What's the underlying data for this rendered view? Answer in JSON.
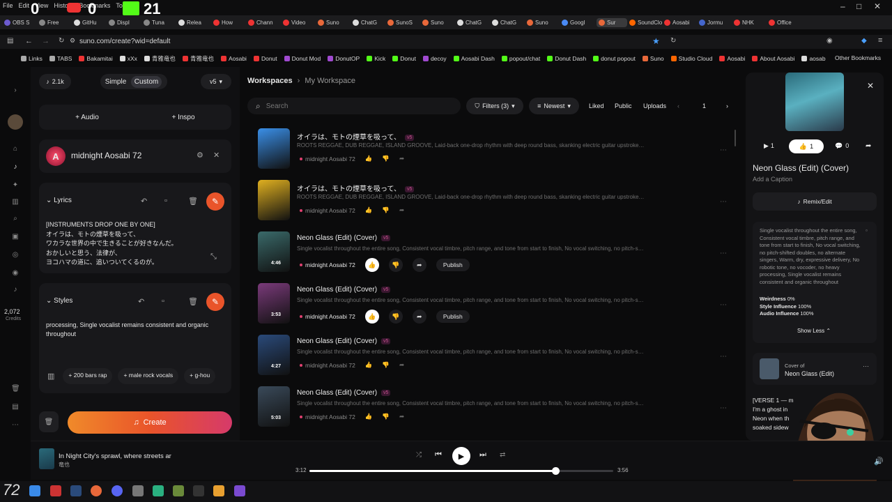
{
  "os": {
    "menu": [
      "File",
      "Edit",
      "View",
      "History",
      "Bookmarks",
      "Tools"
    ],
    "counter1": "0",
    "counter2": "0",
    "counter3": "21"
  },
  "tabs": [
    {
      "label": "OBS S",
      "color": "#6d5bd0"
    },
    {
      "label": "Free",
      "color": "#888"
    },
    {
      "label": "GitHu",
      "color": "#ddd"
    },
    {
      "label": "Displ",
      "color": "#888"
    },
    {
      "label": "Tuna",
      "color": "#888"
    },
    {
      "label": "Relea",
      "color": "#ddd"
    },
    {
      "label": "How",
      "color": "#e33"
    },
    {
      "label": "Chann",
      "color": "#e33"
    },
    {
      "label": "Video",
      "color": "#e33"
    },
    {
      "label": "Suno",
      "color": "#e8683a"
    },
    {
      "label": "ChatG",
      "color": "#ddd"
    },
    {
      "label": "SunoS",
      "color": "#e8683a"
    },
    {
      "label": "Suno",
      "color": "#e8683a"
    },
    {
      "label": "ChatG",
      "color": "#ddd"
    },
    {
      "label": "ChatG",
      "color": "#ddd"
    },
    {
      "label": "Suno",
      "color": "#e8683a"
    },
    {
      "label": "Googl",
      "color": "#4a8af4"
    },
    {
      "label": "Sur",
      "color": "#e8683a",
      "active": true
    },
    {
      "label": "SoundClou",
      "color": "#f60"
    },
    {
      "label": "Aosabi",
      "color": "#e33"
    },
    {
      "label": "Jormu",
      "color": "#4466cc"
    },
    {
      "label": "NHK",
      "color": "#e33"
    },
    {
      "label": "Office",
      "color": "#e33"
    }
  ],
  "address": {
    "url": "suno.com/create?wid=default"
  },
  "bookmarks": [
    {
      "label": "Links",
      "color": "#aaa"
    },
    {
      "label": "TABS",
      "color": "#aaa"
    },
    {
      "label": "Bakamitai",
      "color": "#e33"
    },
    {
      "label": "xXx",
      "color": "#ddd"
    },
    {
      "label": "青雅竜也",
      "color": "#ddd"
    },
    {
      "label": "青雅竜也",
      "color": "#e33"
    },
    {
      "label": "Aosabi",
      "color": "#e33"
    },
    {
      "label": "Donut",
      "color": "#e33"
    },
    {
      "label": "Donut Mod",
      "color": "#a04ad0"
    },
    {
      "label": "DonutOP",
      "color": "#a04ad0"
    },
    {
      "label": "Kick",
      "color": "#53fc18"
    },
    {
      "label": "Donut",
      "color": "#53fc18"
    },
    {
      "label": "decoy",
      "color": "#a04ad0"
    },
    {
      "label": "Aosabi Dash",
      "color": "#53fc18"
    },
    {
      "label": "popout/chat",
      "color": "#53fc18"
    },
    {
      "label": "Donut Dash",
      "color": "#53fc18"
    },
    {
      "label": "donut popout",
      "color": "#53fc18"
    },
    {
      "label": "Suno",
      "color": "#e8683a"
    },
    {
      "label": "Studio Cloud",
      "color": "#f60"
    },
    {
      "label": "Aosabi",
      "color": "#e33"
    },
    {
      "label": "About Aosabi",
      "color": "#e33"
    },
    {
      "label": "aosab",
      "color": "#ddd"
    }
  ],
  "bookmarks_other": "Other Bookmarks",
  "rail": {
    "credits_value": "2,072",
    "credits_label": "Credits"
  },
  "panel": {
    "count": "2.1k",
    "mode_simple": "Simple",
    "mode_custom": "Custom",
    "version": "v5",
    "audio": "Audio",
    "inspo": "Inspo",
    "persona": "midnight Aosabi 72",
    "lyrics_title": "Lyrics",
    "lyrics": [
      "[INSTRUMENTS DROP ONE BY ONE]",
      "オイラは、モトの煙草を吸って、",
      "ワカラな世界の中で生きることが好きなんだ。",
      "おかしいと思う、法律が、",
      "ヨコハマの道に、追いついてくるのが。"
    ],
    "styles_title": "Styles",
    "styles_text": "processing, Single vocalist remains consistent and organic throughout",
    "tags": [
      "200 bars rap",
      "male rock vocals",
      "g-hou"
    ],
    "create": "Create"
  },
  "main": {
    "crumb_root": "Workspaces",
    "crumb_current": "My Workspace",
    "search_placeholder": "Search",
    "filters": "Filters (3)",
    "sort": "Newest",
    "liked": "Liked",
    "public": "Public",
    "uploads": "Uploads",
    "page": "1",
    "rows": [
      {
        "title": "オイラは、モトの煙草を吸って、",
        "badge": "v5",
        "desc": "ROOTS REGGAE, DUB REGGAE, ISLAND GROOVE, Laid-back one-drop rhythm with deep round bass, skanking electric guitar upstrokes, rimsh...",
        "author": "midnight Aosabi 72",
        "duration": "",
        "thumb": "#3a8fe8",
        "on": false
      },
      {
        "title": "オイラは、モトの煙草を吸って、",
        "badge": "v5",
        "desc": "ROOTS REGGAE, DUB REGGAE, ISLAND GROOVE, Laid-back one-drop rhythm with deep round bass, skanking electric guitar upstrokes, rimsh...",
        "author": "midnight Aosabi 72",
        "duration": "",
        "thumb": "#e0b020",
        "on": false
      },
      {
        "title": "Neon Glass (Edit) (Cover)",
        "badge": "v5",
        "desc": "Single vocalist throughout the entire song, Consistent vocal timbre, pitch range, and tone from start to finish, No vocal switching, no pitch-shifted ...",
        "author": "midnight Aosabi 72",
        "duration": "4:46",
        "thumb": "#3a6a6a",
        "on": true,
        "publish": "Publish"
      },
      {
        "title": "Neon Glass (Edit) (Cover)",
        "badge": "v5",
        "desc": "Single vocalist throughout the entire song, Consistent vocal timbre, pitch range, and tone from start to finish, No vocal switching, no pitch-shifted ...",
        "author": "midnight Aosabi 72",
        "duration": "3:53",
        "thumb": "#7a3a7a",
        "on": true,
        "publish": "Publish"
      },
      {
        "title": "Neon Glass (Edit) (Cover)",
        "badge": "v5",
        "desc": "Single vocalist throughout the entire song, Consistent vocal timbre, pitch range, and tone from start to finish, No vocal switching, no pitch-shifted ...",
        "author": "midnight Aosabi 72",
        "duration": "4:27",
        "thumb": "#2a4a7a",
        "on": false
      },
      {
        "title": "Neon Glass (Edit) (Cover)",
        "badge": "v5",
        "desc": "Single vocalist throughout the entire song, Consistent vocal timbre, pitch range, and tone from start to finish, No vocal switching, no pitch-shifted ...",
        "author": "midnight Aosabi 72",
        "duration": "5:03",
        "thumb": "#3a4a5a",
        "on": false
      }
    ]
  },
  "detail": {
    "plays": "1",
    "likes": "1",
    "comments": "0",
    "title": "Neon Glass (Edit) (Cover)",
    "caption": "Add a Caption",
    "remix": "Remix/Edit",
    "style_text": "Single vocalist throughout the entire song, Consistent vocal timbre, pitch range, and tone from start to finish, No vocal switching, no pitch-shifted doubles, no alternate singers, Warm, dry, expressive delivery, No robotic tone, no vocoder, no heavy processing, Single vocalist remains consistent and organic throughout",
    "weirdness_label": "Weirdness",
    "weirdness": "0%",
    "style_inf_label": "Style Influence",
    "style_inf": "100%",
    "audio_inf_label": "Audio Influence",
    "audio_inf": "100%",
    "show_less": "Show Less",
    "cover_of": "Cover of",
    "cover_title": "Neon Glass (Edit)",
    "lyrics_preview": [
      "[VERSE 1 — m",
      "I'm a ghost in",
      "Neon when th",
      "soaked sidew"
    ]
  },
  "player": {
    "title": "In Night City's sprawl, where streets ar",
    "artist": "竜也",
    "elapsed": "3:12",
    "total": "3:56",
    "progress": 0.81
  },
  "colors": {
    "accent": "#e9542a",
    "like": "#ffffff"
  }
}
